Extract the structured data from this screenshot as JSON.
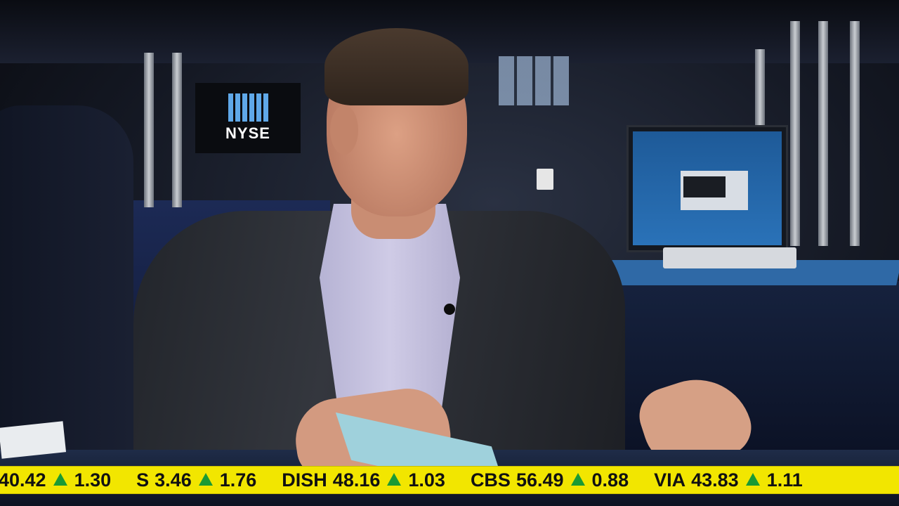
{
  "sign": {
    "text": "NYSE"
  },
  "ticker": {
    "background_color": "#f2e600",
    "up_color": "#1a9a34",
    "items": [
      {
        "symbol": "",
        "price": "40.42",
        "direction": "up-arrow-icon",
        "change": "1.30"
      },
      {
        "symbol": "S",
        "price": "3.46",
        "direction": "up-arrow-icon",
        "change": "1.76"
      },
      {
        "symbol": "DISH",
        "price": "48.16",
        "direction": "up-arrow-icon",
        "change": "1.03"
      },
      {
        "symbol": "CBS",
        "price": "56.49",
        "direction": "up-arrow-icon",
        "change": "0.88"
      },
      {
        "symbol": "VIA",
        "price": "43.83",
        "direction": "up-arrow-icon",
        "change": "1.11"
      }
    ]
  }
}
